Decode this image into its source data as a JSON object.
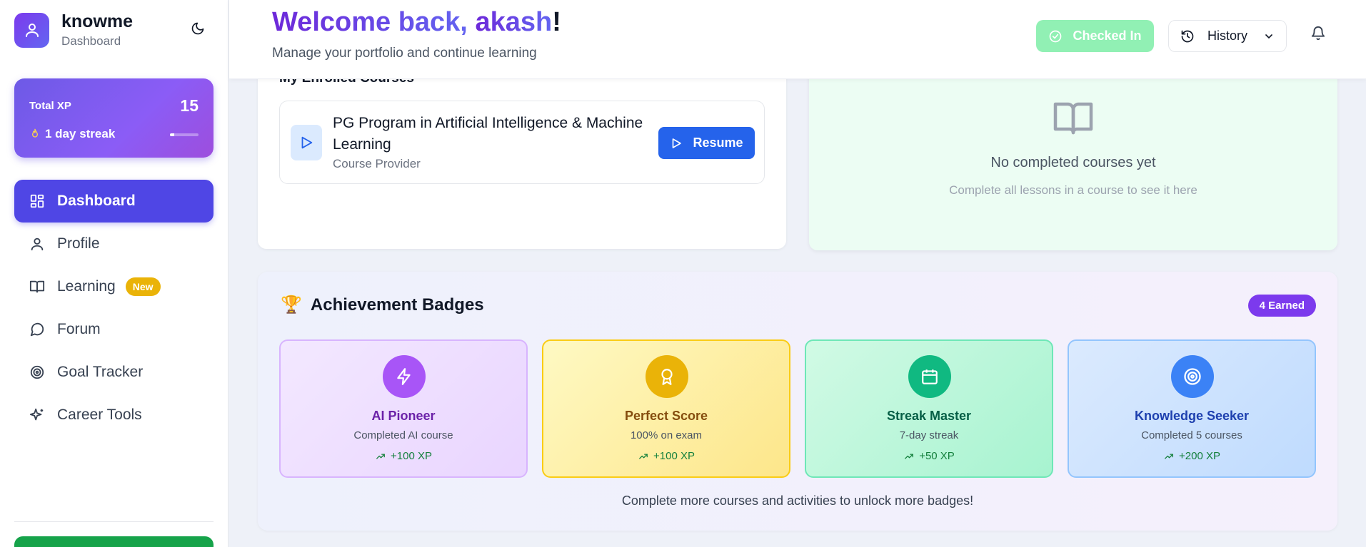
{
  "brand": {
    "name": "knowme",
    "subtitle": "Dashboard"
  },
  "xp": {
    "label": "Total XP",
    "value": "15",
    "streak": "1 day streak",
    "streak_progress": 0.14
  },
  "sidebar": {
    "items": [
      {
        "label": "Dashboard",
        "icon": "dashboard-icon",
        "active": true
      },
      {
        "label": "Profile",
        "icon": "user-icon"
      },
      {
        "label": "Learning",
        "icon": "book-icon",
        "badge": "New"
      },
      {
        "label": "Forum",
        "icon": "chat-icon"
      },
      {
        "label": "Goal Tracker",
        "icon": "target-icon"
      },
      {
        "label": "Career Tools",
        "icon": "sparkles-icon"
      }
    ]
  },
  "header": {
    "welcome_prefix": "Welcome back, ",
    "username": "akash",
    "welcome_suffix": "!",
    "subtitle": "Manage your portfolio and continue learning",
    "checkin_label": "Checked In",
    "history_label": "History"
  },
  "enrolled": {
    "title": "My Enrolled Courses",
    "courses": [
      {
        "title": "PG Program in Artificial Intelligence & Machine Learning",
        "provider": "Course Provider",
        "action": "Resume"
      }
    ]
  },
  "completed": {
    "empty_title": "No completed courses yet",
    "empty_hint": "Complete all lessons in a course to see it here"
  },
  "achievements": {
    "title": "Achievement Badges",
    "earned": "4 Earned",
    "badges": [
      {
        "name": "AI Pioneer",
        "desc": "Completed AI course",
        "xp": "+100 XP",
        "color": "#a855f7",
        "name_color": "#6b21a8",
        "icon": "bolt-icon"
      },
      {
        "name": "Perfect Score",
        "desc": "100% on exam",
        "xp": "+100 XP",
        "color": "#eab308",
        "name_color": "#854d0e",
        "icon": "award-icon"
      },
      {
        "name": "Streak Master",
        "desc": "7-day streak",
        "xp": "+50 XP",
        "color": "#10b981",
        "name_color": "#065f46",
        "icon": "calendar-icon"
      },
      {
        "name": "Knowledge Seeker",
        "desc": "Completed 5 courses",
        "xp": "+200 XP",
        "color": "#3b82f6",
        "name_color": "#1e40af",
        "icon": "target-icon"
      }
    ],
    "footer": "Complete more courses and activities to unlock more badges!"
  },
  "colors": {
    "primary": "#4f46e5",
    "accent_purple": "#7c3aed",
    "resume_blue": "#2563eb",
    "checkin_green": "#86efac"
  }
}
